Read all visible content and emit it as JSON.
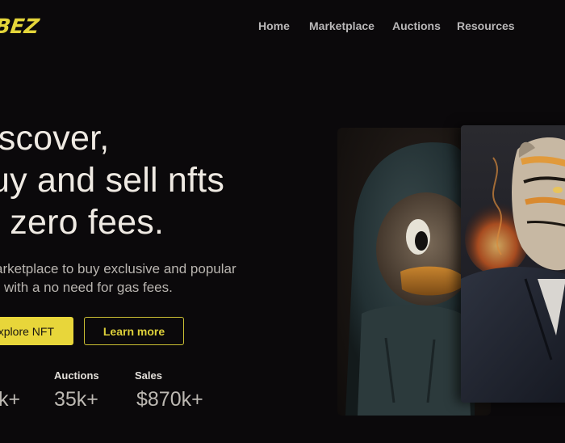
{
  "brand": {
    "logo_text": "BEZ",
    "accent_color": "#e8d63a"
  },
  "nav": {
    "items": [
      {
        "label": "Home"
      },
      {
        "label": "Marketplace"
      },
      {
        "label": "Auctions"
      },
      {
        "label": "Resources"
      }
    ]
  },
  "hero": {
    "title_lines": [
      "iscover,",
      "uy and sell nfts",
      "t zero fees."
    ],
    "subtitle_lines": [
      "arketplace to buy exclusive and popular",
      "with a no need for gas fees."
    ],
    "primary_button": "xplore NFT",
    "secondary_button": "Learn more"
  },
  "stats": [
    {
      "label": "",
      "value": "k+"
    },
    {
      "label": "Auctions",
      "value": "35k+"
    },
    {
      "label": "Sales",
      "value": "$870k+"
    }
  ],
  "artwork": {
    "back_card_icon": "hooded-duck-art",
    "front_card_icon": "tiger-in-suit-art"
  }
}
